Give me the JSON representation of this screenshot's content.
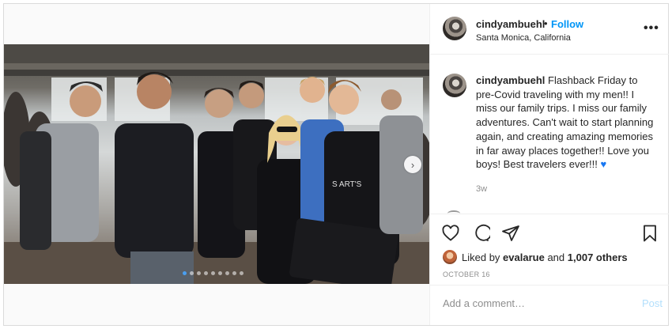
{
  "post": {
    "username": "cindyambuehl",
    "follow_separator": "•",
    "follow_label": "Follow",
    "location": "Santa Monica, California",
    "more_label": "•••"
  },
  "caption": {
    "username": "cindyambuehl",
    "text": "Flashback Friday to pre-Covid traveling with my men!! I miss our family trips. I miss our family adventures. Can't wait to start planning again, and creating amazing memories in far away places together!! Love you boys! Best travelers ever!!!",
    "emoji": "♥",
    "time": "3w"
  },
  "likes": {
    "prefix": "Liked by",
    "user": "evalarue",
    "connector": "and",
    "others": "1,007 others"
  },
  "date": "OCTOBER 16",
  "comment": {
    "placeholder": "Add a comment…",
    "post_label": "Post"
  },
  "carousel": {
    "total": 9,
    "active_index": 0
  },
  "colors": {
    "accent": "#0095f6",
    "heart_emoji": "#1877f2",
    "post_disabled": "#b2dffc",
    "muted": "#8e8e8e"
  }
}
